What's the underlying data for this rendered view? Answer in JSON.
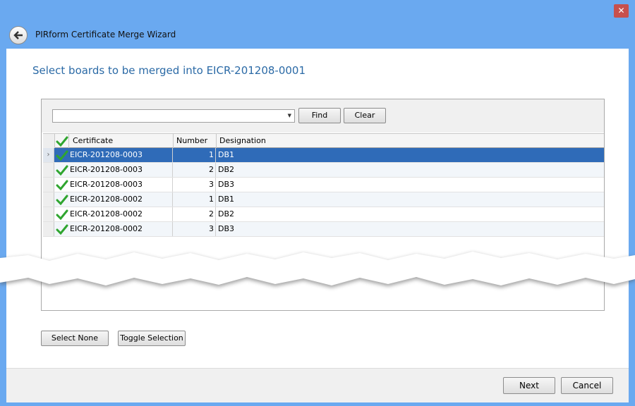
{
  "window": {
    "title": "PIRform Certificate Merge Wizard",
    "close_glyph": "✕"
  },
  "heading": "Select boards to be merged into EICR-201208-0001",
  "search": {
    "value": "",
    "find_label": "Find",
    "clear_label": "Clear"
  },
  "grid": {
    "columns": [
      "Certificate",
      "Number",
      "Designation"
    ],
    "rows": [
      {
        "certificate": "EICR-201208-0003",
        "number": "1",
        "designation": "DB1",
        "checked": true
      },
      {
        "certificate": "EICR-201208-0003",
        "number": "2",
        "designation": "DB2",
        "checked": true
      },
      {
        "certificate": "EICR-201208-0003",
        "number": "3",
        "designation": "DB3",
        "checked": true
      },
      {
        "certificate": "EICR-201208-0002",
        "number": "1",
        "designation": "DB1",
        "checked": true
      },
      {
        "certificate": "EICR-201208-0002",
        "number": "2",
        "designation": "DB2",
        "checked": true
      },
      {
        "certificate": "EICR-201208-0002",
        "number": "3",
        "designation": "DB3",
        "checked": true
      }
    ],
    "row_indicator": "›"
  },
  "actions": {
    "select_none_label": "Select None",
    "toggle_selection_label": "Toggle Selection"
  },
  "footer": {
    "next_label": "Next",
    "cancel_label": "Cancel"
  },
  "colors": {
    "frame": "#6aa9f0",
    "heading": "#2b6aa6",
    "selection": "#2f6bb8",
    "check": "#2fa52f"
  }
}
